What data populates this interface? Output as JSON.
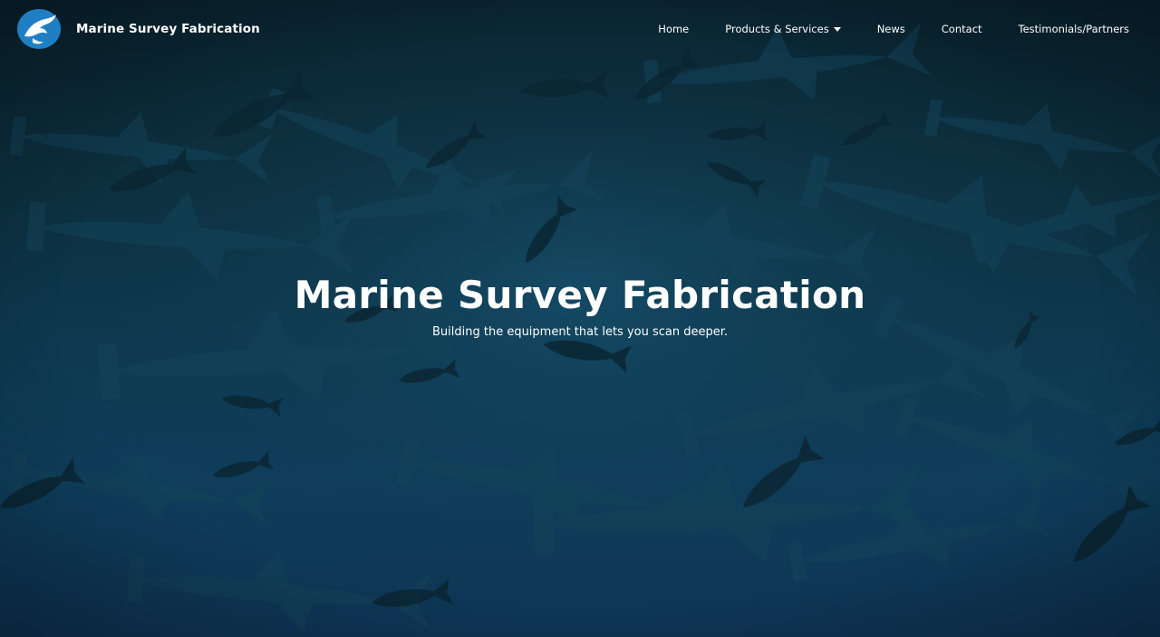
{
  "header": {
    "logo_icon": "shark-logo-icon",
    "brand_name": "Marine Survey Fabrication"
  },
  "nav": {
    "items": [
      {
        "label": "Home"
      },
      {
        "label": "Products & Services",
        "has_dropdown": true,
        "icon": "caret-down-icon"
      },
      {
        "label": "News"
      },
      {
        "label": "Contact"
      },
      {
        "label": "Testimonials/Partners"
      }
    ]
  },
  "hero": {
    "title": "Marine Survey Fabrication",
    "subtitle": "Building the equipment that lets you scan deeper."
  },
  "colors": {
    "background_top": "#0a2430",
    "background_bottom": "#0f3f5e",
    "logo_blue": "#1f7fc4",
    "text": "#ffffff"
  }
}
